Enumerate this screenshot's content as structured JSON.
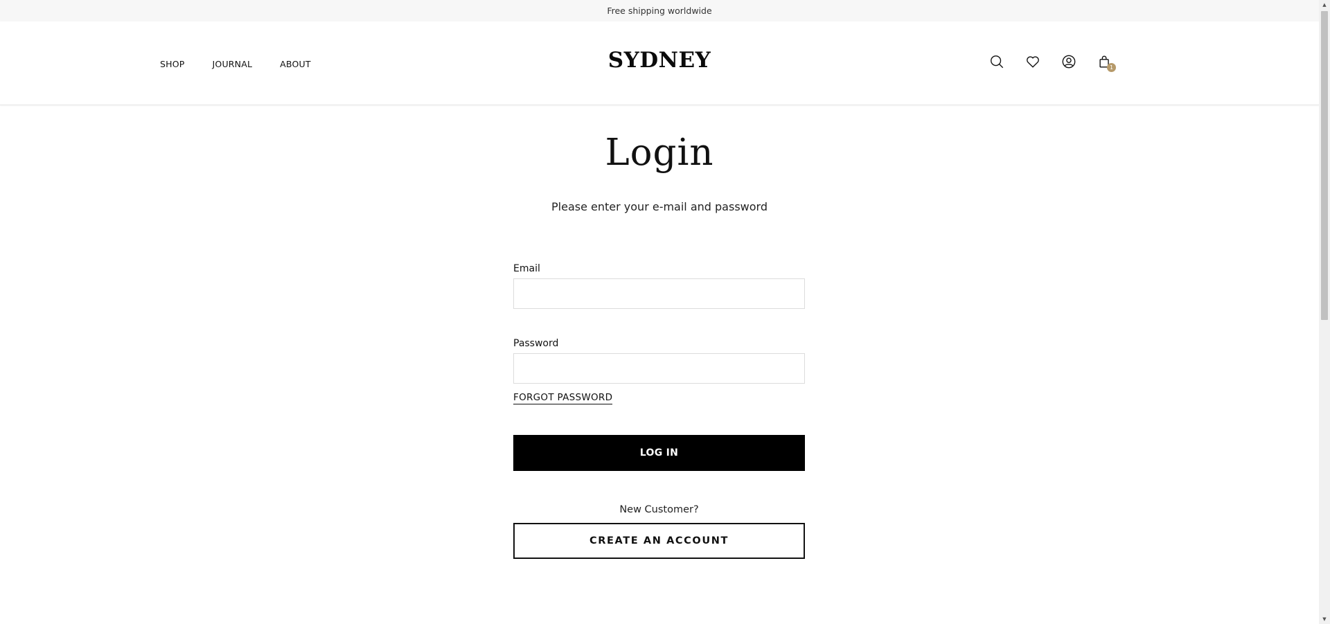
{
  "announcement": {
    "text": "Free shipping worldwide"
  },
  "header": {
    "nav": [
      {
        "label": "SHOP"
      },
      {
        "label": "JOURNAL"
      },
      {
        "label": "ABOUT"
      }
    ],
    "logo": "SYDNEY",
    "icons": [
      "search-icon",
      "heart-icon",
      "account-icon",
      "cart-icon"
    ],
    "cart_count": "1",
    "cart_badge_color": "#b69a6a"
  },
  "main": {
    "title": "Login",
    "subtitle": "Please enter your e-mail and password",
    "email": {
      "label": "Email",
      "value": "",
      "placeholder": ""
    },
    "password": {
      "label": "Password",
      "value": "",
      "placeholder": ""
    },
    "forgot_label": "FORGOT PASSWORD",
    "login_label": "LOG IN",
    "new_customer_text": "New Customer?",
    "create_label": "CREATE AN ACCOUNT"
  },
  "colors": {
    "primary_button": "#000000",
    "background": "#ffffff",
    "announcement_bg": "#f7f7f7"
  }
}
